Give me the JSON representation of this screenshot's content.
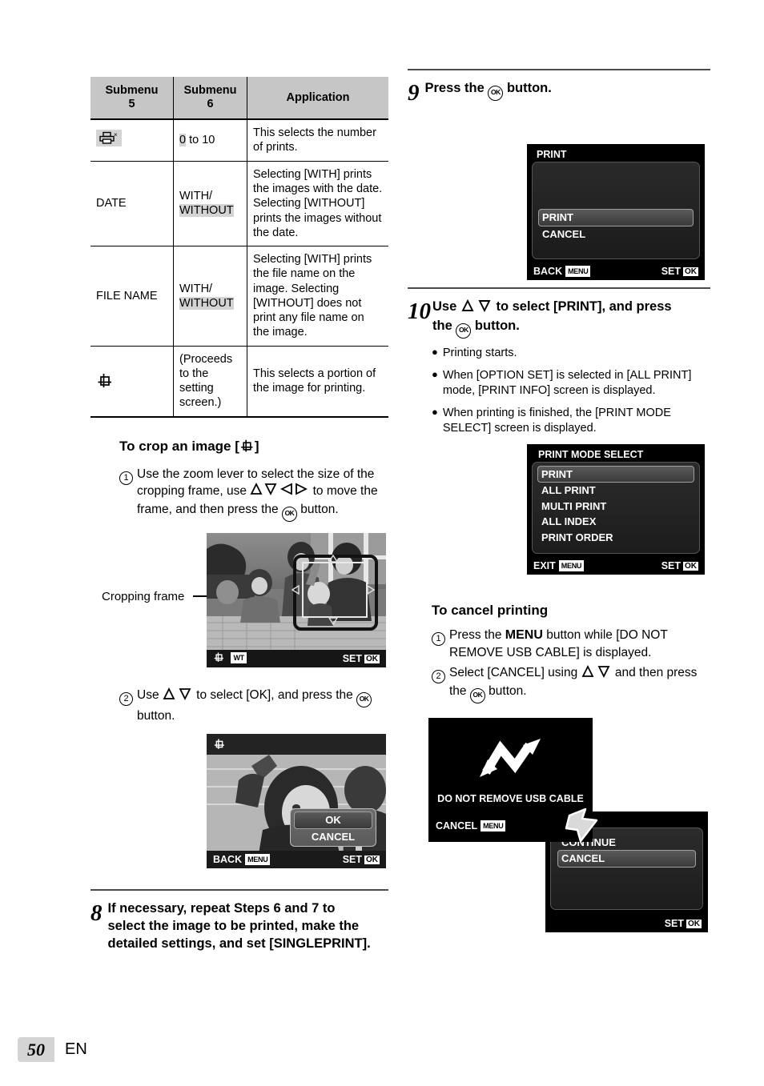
{
  "table": {
    "headers": [
      "Submenu\n5",
      "Submenu\n6",
      "Application"
    ],
    "header_labels": {
      "sub5_l1": "Submenu",
      "sub5_l2": "5",
      "sub6_l1": "Submenu",
      "sub6_l2": "6",
      "application": "Application"
    },
    "rows": [
      {
        "submenu5": "",
        "submenu5_icon": "printer-multiply-icon",
        "submenu6_prefix": "0",
        "submenu6_rest": " to 10",
        "application": "This selects the number of prints."
      },
      {
        "submenu5": "DATE",
        "submenu6_prefix": "WITH/",
        "submenu6_rest": "WITHOUT",
        "application": "Selecting [WITH] prints the images with the date. Selecting [WITHOUT] prints the images without the date."
      },
      {
        "submenu5": "FILE NAME",
        "submenu6_prefix": "WITH/",
        "submenu6_rest": "WITHOUT",
        "application": "Selecting [WITH] prints the file name on the image. Selecting [WITHOUT] does not print any file name on the image."
      },
      {
        "submenu5": "",
        "submenu5_icon": "crop-icon",
        "submenu6_prefix": "(Proceeds to the setting screen.)",
        "submenu6_rest": "",
        "application": "This selects a portion of the image for printing."
      }
    ]
  },
  "crop_section": {
    "heading_prefix": "To crop an image [",
    "heading_suffix": "]",
    "heading_icon": "crop-icon",
    "step1": {
      "num": "1",
      "part1": "Use the zoom lever to select the size of the cropping frame, use ",
      "part2": " to move the frame, and then press the ",
      "part3": " button.",
      "arrows": "up-down-left-right-arrows-icon",
      "ok_glyph": "OK"
    },
    "step2": {
      "num": "2",
      "part1": "Use ",
      "part2": " to select [OK], and press the ",
      "part3": " button.",
      "arrows": "up-down-arrows-icon",
      "ok_glyph": "OK"
    },
    "leader_label": "Cropping frame"
  },
  "lcd_crop_frame": {
    "crop_icon": "crop-icon",
    "wt_badge": "WT",
    "set_label": "SET",
    "ok_badge": "OK"
  },
  "lcd_crop_confirm": {
    "title_icon": "crop-icon",
    "items": [
      {
        "label": "OK",
        "selected": true
      },
      {
        "label": "CANCEL",
        "selected": false
      }
    ],
    "back_label": "BACK",
    "menu_badge": "MENU",
    "set_label": "SET",
    "ok_badge": "OK"
  },
  "step8": {
    "num": "8",
    "text": "If necessary, repeat Steps 6 and 7 to select the image to be printed, make the detailed settings, and set [SINGLEPRINT]."
  },
  "step9": {
    "num": "9",
    "part1": "Press the ",
    "part2": " button.",
    "ok_glyph": "OK"
  },
  "lcd_print": {
    "title": "PRINT",
    "items": [
      {
        "label": "PRINT",
        "selected": true
      },
      {
        "label": "CANCEL",
        "selected": false
      }
    ],
    "back_label": "BACK",
    "menu_badge": "MENU",
    "set_label": "SET",
    "ok_badge": "OK"
  },
  "step10": {
    "num": "10",
    "part1": "Use ",
    "part2": " to select [PRINT], and press the ",
    "part3": " button.",
    "arrows": "up-down-arrows-icon",
    "ok_glyph": "OK",
    "bullets": [
      "Printing starts.",
      "When [OPTION SET] is selected in [ALL PRINT] mode, [PRINT INFO] screen is displayed.",
      "When printing is finished, the [PRINT MODE SELECT] screen is displayed."
    ]
  },
  "lcd_print_mode_select": {
    "title": "PRINT MODE SELECT",
    "items": [
      {
        "label": "PRINT",
        "selected": true
      },
      {
        "label": "ALL PRINT",
        "selected": false
      },
      {
        "label": "MULTI PRINT",
        "selected": false
      },
      {
        "label": "ALL INDEX",
        "selected": false
      },
      {
        "label": "PRINT ORDER",
        "selected": false
      }
    ],
    "exit_label": "EXIT",
    "menu_badge": "MENU",
    "set_label": "SET",
    "ok_badge": "OK"
  },
  "cancel_section": {
    "heading": "To cancel printing",
    "step1": {
      "num": "1",
      "part1": "Press the ",
      "menu": "MENU",
      "part2": " button while [DO NOT REMOVE USB CABLE]  is displayed."
    },
    "step2": {
      "num": "2",
      "part1": "Select [CANCEL] using ",
      "part2": " and then press the ",
      "part3": " button.",
      "arrows": "up-down-arrows-icon",
      "ok_glyph": "OK"
    }
  },
  "lcd_usb": {
    "icon": "usb-transfer-arrows-icon",
    "message": "DO NOT REMOVE USB CABLE",
    "cancel_label": "CANCEL",
    "menu_badge": "MENU"
  },
  "lcd_continue": {
    "items": [
      {
        "label": "CONTINUE",
        "selected": false
      },
      {
        "label": "CANCEL",
        "selected": true
      }
    ],
    "set_label": "SET",
    "ok_badge": "OK"
  },
  "footer": {
    "page_number": "50",
    "language": "EN"
  },
  "colors": {
    "table_header_bg": "#c6c6c6",
    "highlight_bg": "#d4d4d4",
    "lcd_bg": "#000000",
    "lcd_text": "#ffffff",
    "rule": "#4a4a4a"
  }
}
